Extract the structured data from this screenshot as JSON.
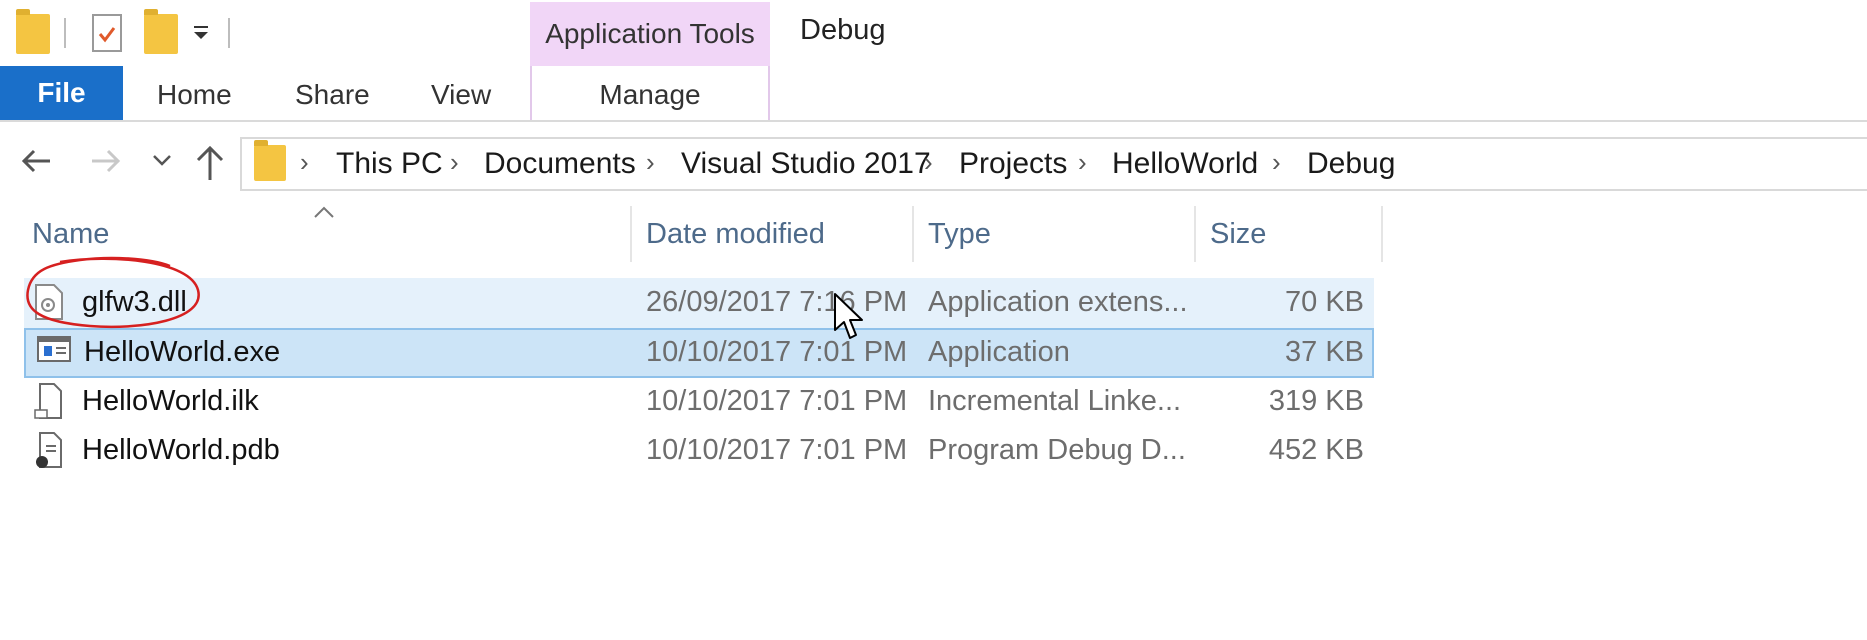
{
  "window": {
    "context_tab_label": "Application Tools",
    "context_title": "Debug",
    "manage_tab_label": "Manage"
  },
  "ribbon": {
    "tabs": [
      {
        "label": "File"
      },
      {
        "label": "Home"
      },
      {
        "label": "Share"
      },
      {
        "label": "View"
      }
    ]
  },
  "address": {
    "breadcrumbs": [
      "This PC",
      "Documents",
      "Visual Studio 2017",
      "Projects",
      "HelloWorld",
      "Debug"
    ]
  },
  "columns": {
    "name": "Name",
    "date": "Date modified",
    "type": "Type",
    "size": "Size"
  },
  "files": [
    {
      "name": "glfw3.dll",
      "date": "26/09/2017 7:16 PM",
      "type": "Application extens...",
      "size": "70 KB",
      "icon": "dll-file-icon",
      "state": "hover"
    },
    {
      "name": "HelloWorld.exe",
      "date": "10/10/2017 7:01 PM",
      "type": "Application",
      "size": "37 KB",
      "icon": "exe-file-icon",
      "state": "selected"
    },
    {
      "name": "HelloWorld.ilk",
      "date": "10/10/2017 7:01 PM",
      "type": "Incremental Linke...",
      "size": "319 KB",
      "icon": "ilk-file-icon",
      "state": "normal"
    },
    {
      "name": "HelloWorld.pdb",
      "date": "10/10/2017 7:01 PM",
      "type": "Program Debug D...",
      "size": "452 KB",
      "icon": "pdb-file-icon",
      "state": "normal"
    }
  ],
  "colors": {
    "file_tab": "#1a6fc9",
    "context_tab": "#f1d6f7",
    "selection": "#cce4f7",
    "hover": "#e5f1fb",
    "annotation": "#d62020"
  }
}
